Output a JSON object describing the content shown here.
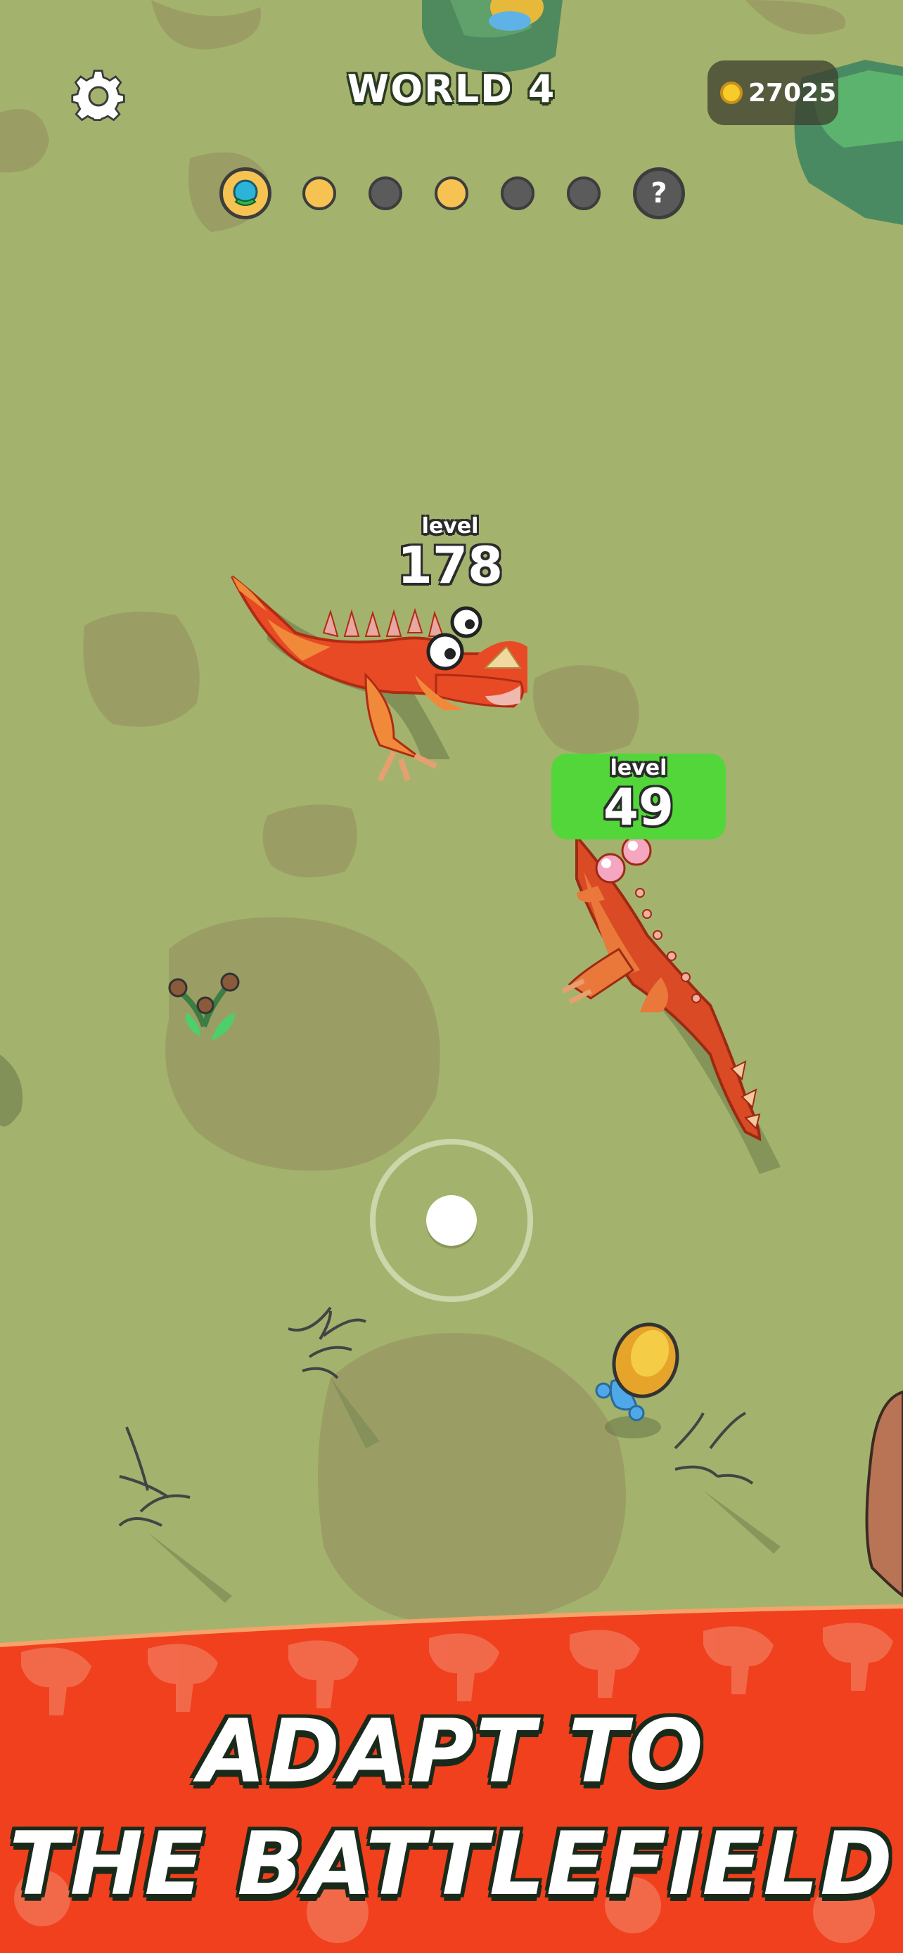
{
  "hud": {
    "world_title": "WORLD 4",
    "coins": "27025",
    "settings_icon": "gear-icon",
    "progress": [
      {
        "state": "current",
        "icon": "creature-icon"
      },
      {
        "state": "done"
      },
      {
        "state": "todo"
      },
      {
        "state": "done"
      },
      {
        "state": "todo"
      },
      {
        "state": "todo"
      },
      {
        "state": "mystery",
        "label": "?"
      }
    ]
  },
  "enemy": {
    "level_label": "level",
    "level_value": "178"
  },
  "player": {
    "level_label": "level",
    "level_value": "49"
  },
  "banner": {
    "line1": "ADAPT TO",
    "line2": "THE BATTLEFIELD"
  },
  "colors": {
    "grass": "#a3b36d",
    "banner_red": "#f0401e",
    "player_tag": "#52d63a",
    "progress_done": "#f6c353"
  }
}
